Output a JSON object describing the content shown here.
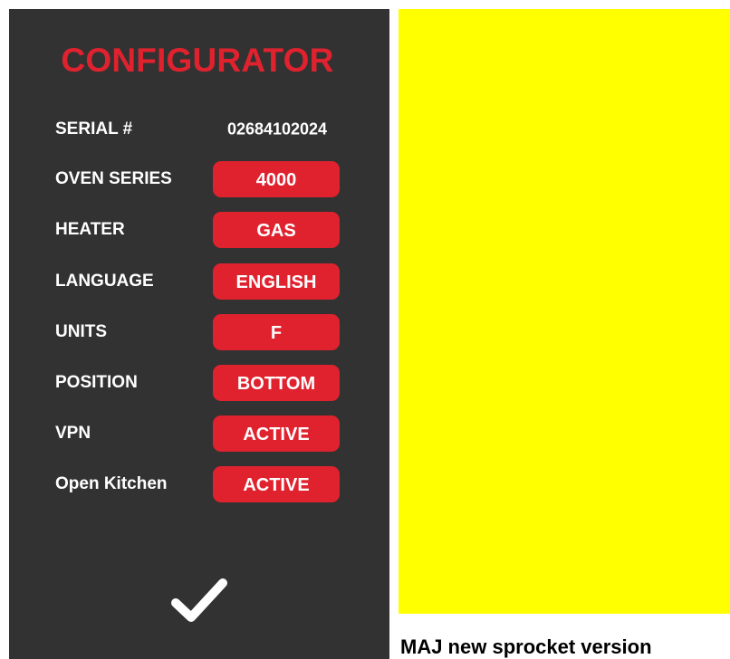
{
  "configurator": {
    "title": "CONFIGURATOR",
    "serial": {
      "label": "SERIAL #",
      "value": "02684102024"
    },
    "settings": [
      {
        "label": "OVEN SERIES",
        "value": "4000"
      },
      {
        "label": "HEATER",
        "value": "GAS"
      },
      {
        "label": "LANGUAGE",
        "value": "ENGLISH"
      },
      {
        "label": "UNITS",
        "value": "F"
      },
      {
        "label": "POSITION",
        "value": "BOTTOM"
      },
      {
        "label": "VPN",
        "value": "ACTIVE"
      },
      {
        "label": "Open Kitchen",
        "value": "ACTIVE"
      }
    ],
    "confirm_icon": "checkmark-icon"
  },
  "caption": "MAJ new sprocket version",
  "colors": {
    "panel_bg": "#323232",
    "accent": "#e0222f",
    "text": "#ffffff",
    "highlight": "#ffff00"
  }
}
